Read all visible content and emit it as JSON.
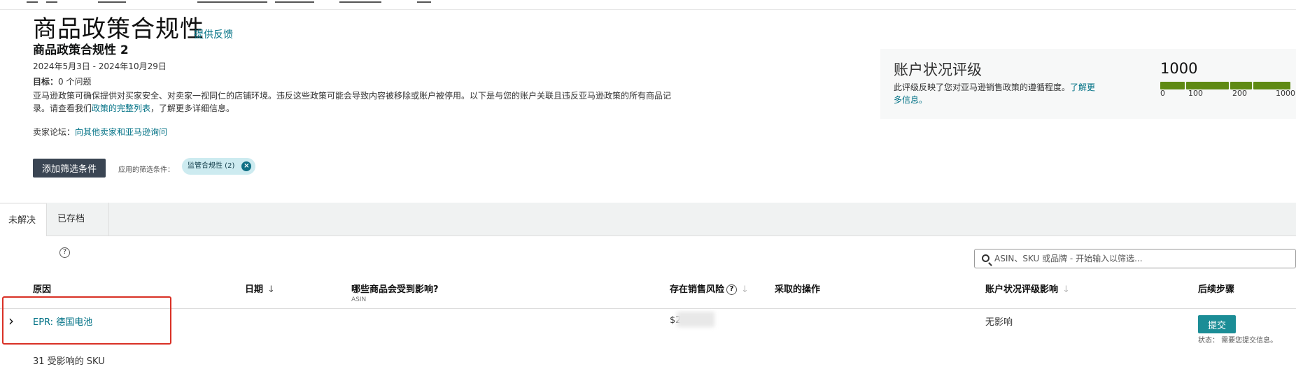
{
  "page": {
    "title": "商品政策合规性",
    "feedback_link": "提供反馈",
    "subtitle": "商品政策合规性 2",
    "date_range": "2024年5月3日 - 2024年10月29日",
    "target_label": "目标：",
    "target_value": "0 个问题",
    "description": "亚马逊政策可确保提供对买家安全、对卖家一视同仁的店铺环境。违反这些政策可能会导致内容被移除或账户被停用。以下是与您的账户关联且违反亚马逊政策的所有商品记录。请查看我们",
    "description_link": "政策的完整列表",
    "description_end": "，了解更多详细信息。",
    "forum_label": "卖家论坛：",
    "forum_link": "向其他卖家和亚马逊询问"
  },
  "filters": {
    "add_button": "添加筛选条件",
    "applied_label": "应用的筛选条件：",
    "chip_label": "监管合规性 (2)"
  },
  "health": {
    "title": "账户状况评级",
    "description": "此评级反映了您对亚马逊销售政策的遵循程度。",
    "learn_more": "了解更多信息。",
    "score": "1000",
    "status_color": "#5f8a14",
    "ticks": [
      "0",
      "100",
      "200",
      "1000"
    ]
  },
  "tabs": {
    "unresolved": "未解决",
    "archived": "已存档"
  },
  "search": {
    "placeholder": "ASIN、SKU 或品牌 - 开始输入以筛选..."
  },
  "table": {
    "columns": {
      "reason": "原因",
      "date": "日期",
      "products": "哪些商品会受到影响?",
      "products_sub": "ASIN",
      "risk": "存在销售风险",
      "action": "采取的操作",
      "impact": "账户状况评级影响",
      "next": "后续步骤"
    },
    "rows": [
      {
        "reason": "EPR: 德国电池",
        "risk_prefix": "$2",
        "impact": "无影响",
        "action_button": "提交",
        "status": "状态：  需要您提交信息。"
      }
    ],
    "sku_count": "31 受影响的 SKU"
  }
}
